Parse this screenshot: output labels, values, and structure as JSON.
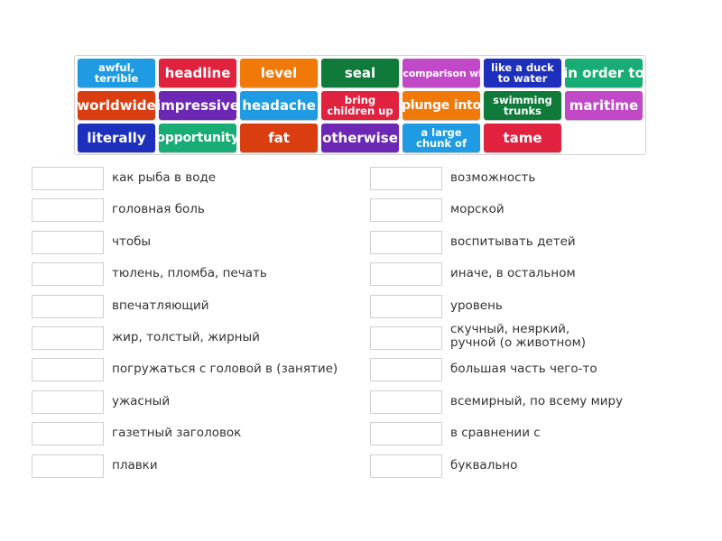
{
  "tiles": [
    {
      "text": "awful, terrible",
      "color": "#1f9be3"
    },
    {
      "text": "headline",
      "color": "#e0223f"
    },
    {
      "text": "level",
      "color": "#f0790a"
    },
    {
      "text": "seal",
      "color": "#0f7a3a"
    },
    {
      "text": "in comparison with",
      "color": "#c148c6"
    },
    {
      "text": "like a duck to water",
      "color": "#1d2fbd"
    },
    {
      "text": "in order to",
      "color": "#19ad76"
    },
    {
      "text": "worldwide",
      "color": "#da3e10"
    },
    {
      "text": "impressive",
      "color": "#6c27b4"
    },
    {
      "text": "headache",
      "color": "#1f9be3"
    },
    {
      "text": "bring children up",
      "color": "#e0223f"
    },
    {
      "text": "plunge into",
      "color": "#f0790a"
    },
    {
      "text": "swimming trunks",
      "color": "#0f7a3a"
    },
    {
      "text": "maritime",
      "color": "#c148c6"
    },
    {
      "text": "literally",
      "color": "#1d2fbd"
    },
    {
      "text": "opportunity",
      "color": "#19ad76"
    },
    {
      "text": "fat",
      "color": "#da3e10"
    },
    {
      "text": "otherwise",
      "color": "#6c27b4"
    },
    {
      "text": "a large chunk of",
      "color": "#1f9be3"
    },
    {
      "text": "tame",
      "color": "#e0223f"
    }
  ],
  "left_items": [
    "как рыба в воде",
    "головная боль",
    "чтобы",
    "тюлень, пломба, печать",
    "впечатляющий",
    "жир, толстый, жирный",
    "погружаться с головой в (занятие)",
    "ужасный",
    "газетный заголовок",
    "плавки"
  ],
  "right_items": [
    "возможность",
    "морской",
    "воспитывать детей",
    "иначе, в остальном",
    "уровень",
    "скучный, неяркий, ручной (о животном)",
    "большая часть чего-то",
    "всемирный, по всему миру",
    "в сравнении с",
    "буквально"
  ]
}
